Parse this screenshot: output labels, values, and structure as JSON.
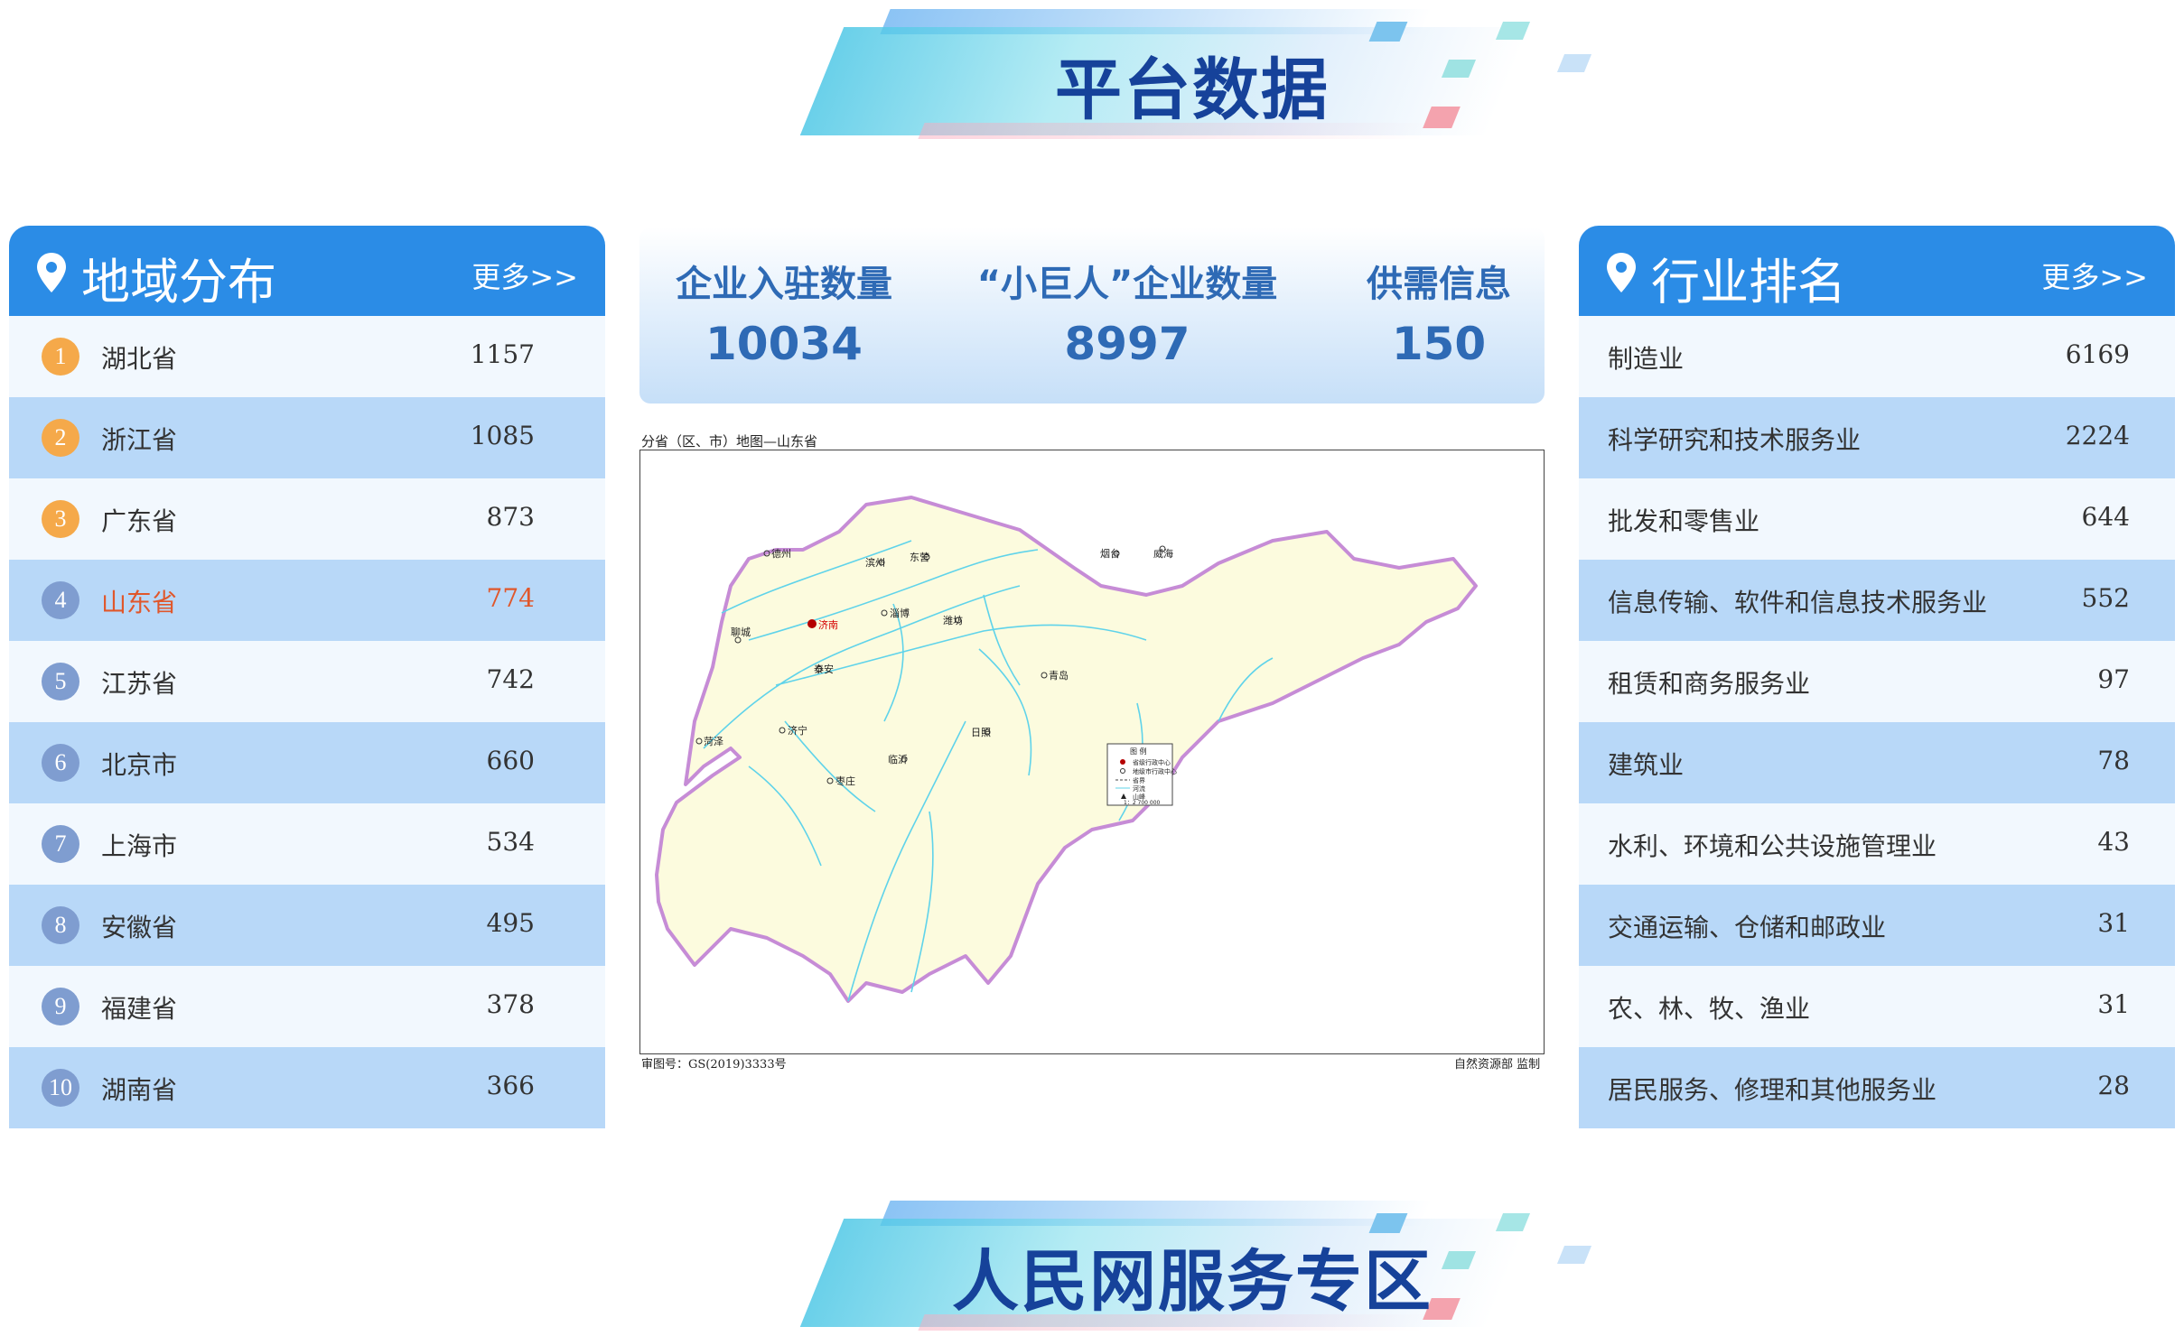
{
  "banner_top": {
    "title": "平台数据"
  },
  "banner_bottom": {
    "title": "人民网服务专区"
  },
  "region": {
    "title": "地域分布",
    "more": "更多>>",
    "rows": [
      {
        "rank": "1",
        "name": "湖北省",
        "value": "1157",
        "badge_color": "#f5a94a"
      },
      {
        "rank": "2",
        "name": "浙江省",
        "value": "1085",
        "badge_color": "#f5a94a"
      },
      {
        "rank": "3",
        "name": "广东省",
        "value": "873",
        "badge_color": "#f5a94a"
      },
      {
        "rank": "4",
        "name": "山东省",
        "value": "774",
        "badge_color": "#7f9dd0"
      },
      {
        "rank": "5",
        "name": "江苏省",
        "value": "742",
        "badge_color": "#7f9dd0"
      },
      {
        "rank": "6",
        "name": "北京市",
        "value": "660",
        "badge_color": "#7f9dd0"
      },
      {
        "rank": "7",
        "name": "上海市",
        "value": "534",
        "badge_color": "#7f9dd0"
      },
      {
        "rank": "8",
        "name": "安徽省",
        "value": "495",
        "badge_color": "#7f9dd0"
      },
      {
        "rank": "9",
        "name": "福建省",
        "value": "378",
        "badge_color": "#7f9dd0"
      },
      {
        "rank": "10",
        "name": "湖南省",
        "value": "366",
        "badge_color": "#7f9dd0"
      }
    ]
  },
  "stats": [
    {
      "label": "企业入驻数量",
      "value": "10034"
    },
    {
      "label": "“小巨人”企业数量",
      "value": "8997"
    },
    {
      "label": "供需信息",
      "value": "150"
    }
  ],
  "map": {
    "caption": "分省（区、市）地图—山东省",
    "review_no": "审图号：GS(2019)3333号",
    "supervisor": "自然资源部 监制",
    "cities": [
      "德州",
      "滨州",
      "东营",
      "烟台",
      "威海",
      "聊城",
      "济南",
      "淄博",
      "潍坊",
      "泰安",
      "青岛",
      "济宁",
      "菏泽",
      "日照",
      "临沂",
      "枣庄"
    ],
    "legend": {
      "title": "图 例",
      "items": [
        "省级行政中心",
        "地级市行政中心",
        "省界",
        "河流",
        "山峰"
      ],
      "scale": "1：2 700 000"
    }
  },
  "industry": {
    "title": "行业排名",
    "more": "更多>>",
    "rows": [
      {
        "name": "制造业",
        "value": "6169"
      },
      {
        "name": "科学研究和技术服务业",
        "value": "2224"
      },
      {
        "name": "批发和零售业",
        "value": "644"
      },
      {
        "name": "信息传输、软件和信息技术服务业",
        "value": "552"
      },
      {
        "name": "租赁和商务服务业",
        "value": "97"
      },
      {
        "name": "建筑业",
        "value": "78"
      },
      {
        "name": "水利、环境和公共设施管理业",
        "value": "43"
      },
      {
        "name": "交通运输、仓储和邮政业",
        "value": "31"
      },
      {
        "name": "农、林、牧、渔业",
        "value": "31"
      },
      {
        "name": "居民服务、修理和其他服务业",
        "value": "28"
      }
    ]
  },
  "colors": {
    "accent": "#2b8ce6",
    "title": "#16429a",
    "stat_text": "#2e6ab5",
    "highlight": "#e0572b"
  }
}
